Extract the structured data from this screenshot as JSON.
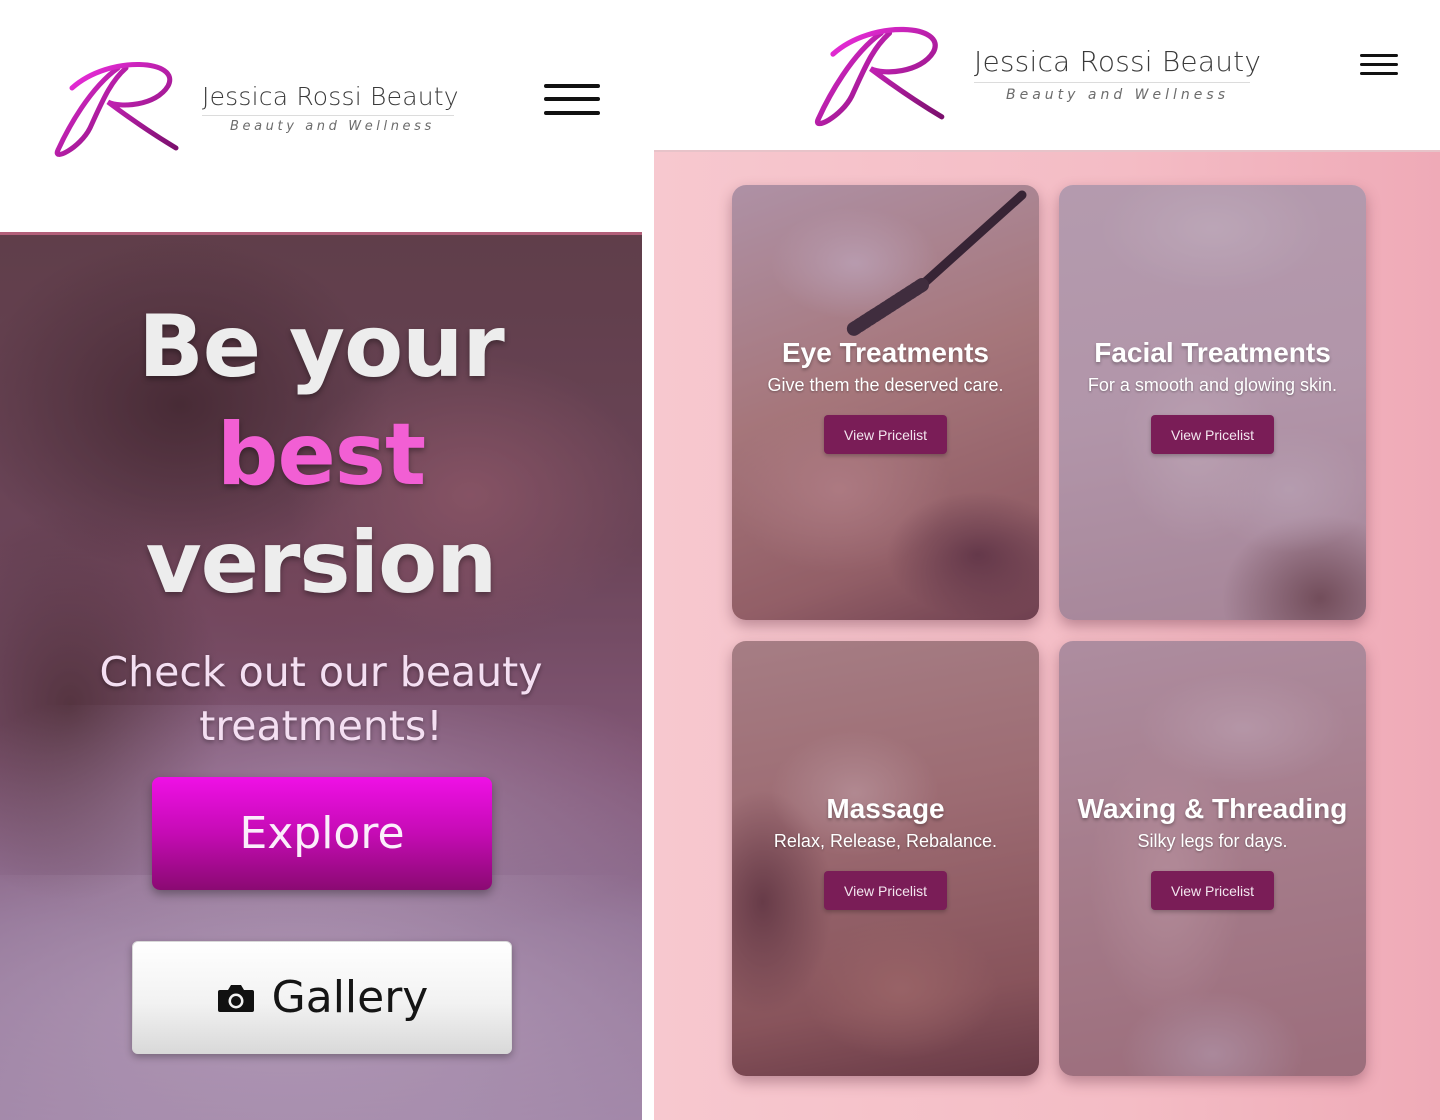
{
  "brand": {
    "name": "Jessica Rossi Beauty",
    "tagline": "Beauty and Wellness",
    "logo_letter": "R",
    "accent": "#d21bc0"
  },
  "hero": {
    "line_1": "Be your",
    "line_2": "best",
    "line_3": "version",
    "subtitle": "Check out our beauty treatments!",
    "explore_label": "Explore",
    "gallery_label": "Gallery",
    "gallery_icon": "camera-icon"
  },
  "services": {
    "cards": [
      {
        "title": "Eye Treatments",
        "desc": "Give them the deserved care.",
        "button": "View Pricelist"
      },
      {
        "title": "Facial Treatments",
        "desc": "For a smooth and glowing skin.",
        "button": "View Pricelist"
      },
      {
        "title": "Massage",
        "desc": "Relax, Release, Rebalance.",
        "button": "View Pricelist"
      },
      {
        "title": "Waxing & Threading",
        "desc": "Silky legs for days.",
        "button": "View Pricelist"
      }
    ]
  },
  "colors": {
    "button_primary": "#c50bb4",
    "button_pricelist": "#7a1d57",
    "services_bg": "#f4bcc5"
  }
}
